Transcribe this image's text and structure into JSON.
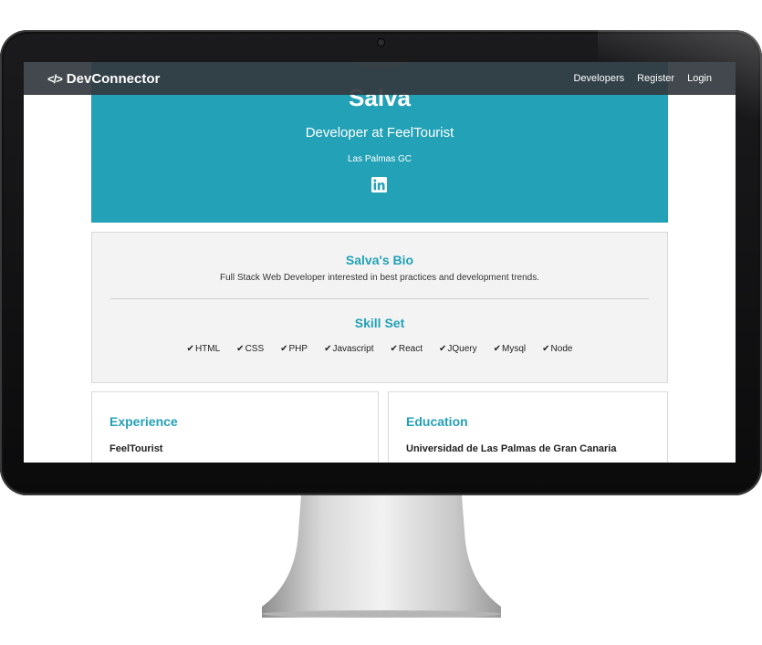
{
  "navbar": {
    "brand_icon": "</>",
    "brand": "DevConnector",
    "links": [
      "Developers",
      "Register",
      "Login"
    ]
  },
  "profile": {
    "name": "Salva",
    "status": "Developer at FeelTourist",
    "location": "Las Palmas GC",
    "social_icon": "linkedin-icon"
  },
  "bio": {
    "title": "Salva's Bio",
    "text": "Full Stack Web Developer interested in best practices and development trends."
  },
  "skills": {
    "title": "Skill Set",
    "check_glyph": "✔",
    "items": [
      "HTML",
      "CSS",
      "PHP",
      "Javascript",
      "React",
      "JQuery",
      "Mysql",
      "Node"
    ]
  },
  "experience": {
    "title": "Experience",
    "first_company": "FeelTourist"
  },
  "education": {
    "title": "Education",
    "first_school": "Universidad de Las Palmas de Gran Canaria"
  },
  "colors": {
    "accent": "#23a1b6",
    "navbar": "#343a40",
    "card_bg": "#f3f3f3"
  }
}
